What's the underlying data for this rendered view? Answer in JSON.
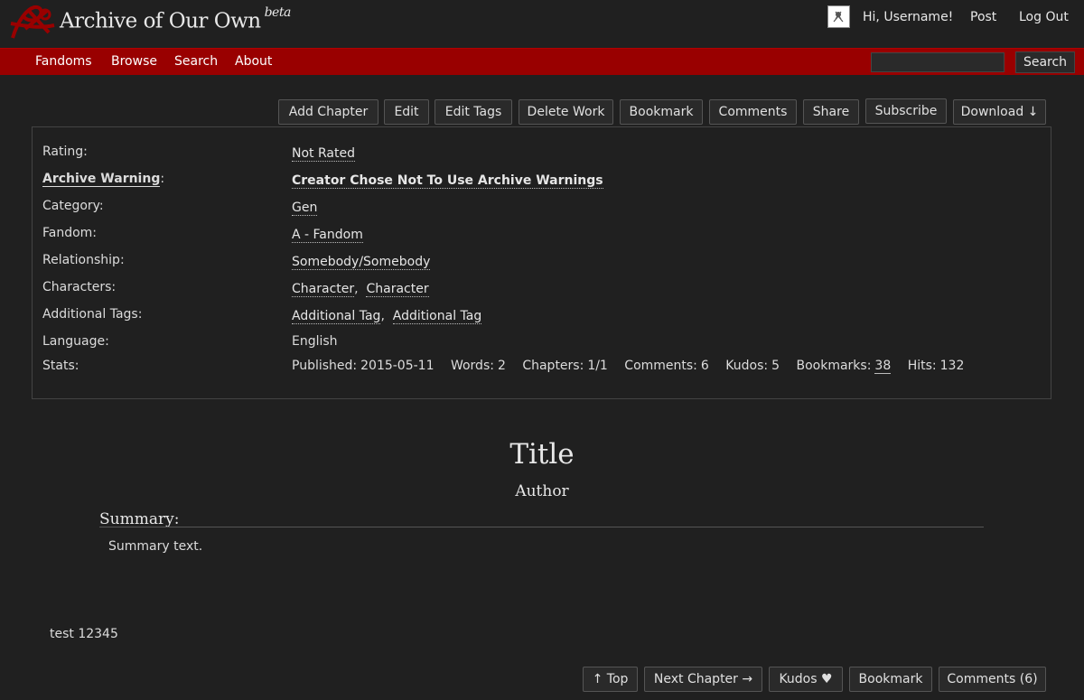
{
  "header": {
    "site_title": "Archive of Our Own",
    "beta": "beta",
    "greeting": "Hi, Username!",
    "post": "Post",
    "logout": "Log Out"
  },
  "nav": {
    "fandoms": "Fandoms",
    "browse": "Browse",
    "search": "Search",
    "about": "About",
    "search_button": "Search",
    "search_value": ""
  },
  "actions": {
    "add_chapter": "Add Chapter",
    "edit": "Edit",
    "edit_tags": "Edit Tags",
    "delete_work": "Delete Work",
    "bookmark": "Bookmark",
    "comments": "Comments",
    "share": "Share",
    "subscribe": "Subscribe",
    "download": "Download ↓"
  },
  "meta": {
    "rating_label": "Rating:",
    "rating": "Not Rated",
    "warning_label": "Archive Warning",
    "warning_colon": ":",
    "warning": "Creator Chose Not To Use Archive Warnings",
    "category_label": "Category:",
    "category": "Gen",
    "fandom_label": "Fandom:",
    "fandom": "A - Fandom",
    "relationship_label": "Relationship:",
    "relationship": "Somebody/Somebody",
    "characters_label": "Characters:",
    "characters": [
      "Character",
      "Character"
    ],
    "additional_tags_label": "Additional Tags:",
    "additional_tags": [
      "Additional Tag",
      "Additional Tag"
    ],
    "language_label": "Language:",
    "language": "English",
    "stats_label": "Stats:",
    "stats": {
      "published_label": "Published:",
      "published": "2015-05-11",
      "words_label": "Words:",
      "words": "2",
      "chapters_label": "Chapters:",
      "chapters": "1/1",
      "comments_label": "Comments:",
      "comments": "6",
      "kudos_label": "Kudos:",
      "kudos": "5",
      "bookmarks_label": "Bookmarks:",
      "bookmarks": "38",
      "hits_label": "Hits:",
      "hits": "132"
    }
  },
  "work": {
    "title": "Title",
    "author": "Author",
    "summary_heading": "Summary:",
    "summary": "Summary text.",
    "chapter_text": "test 12345"
  },
  "footer_actions": {
    "top": "↑ Top",
    "next_chapter": "Next Chapter →",
    "kudos": "Kudos ♥",
    "bookmark": "Bookmark",
    "comments": "Comments (6)"
  },
  "colors": {
    "nav_red": "#990000",
    "background": "#202020"
  }
}
